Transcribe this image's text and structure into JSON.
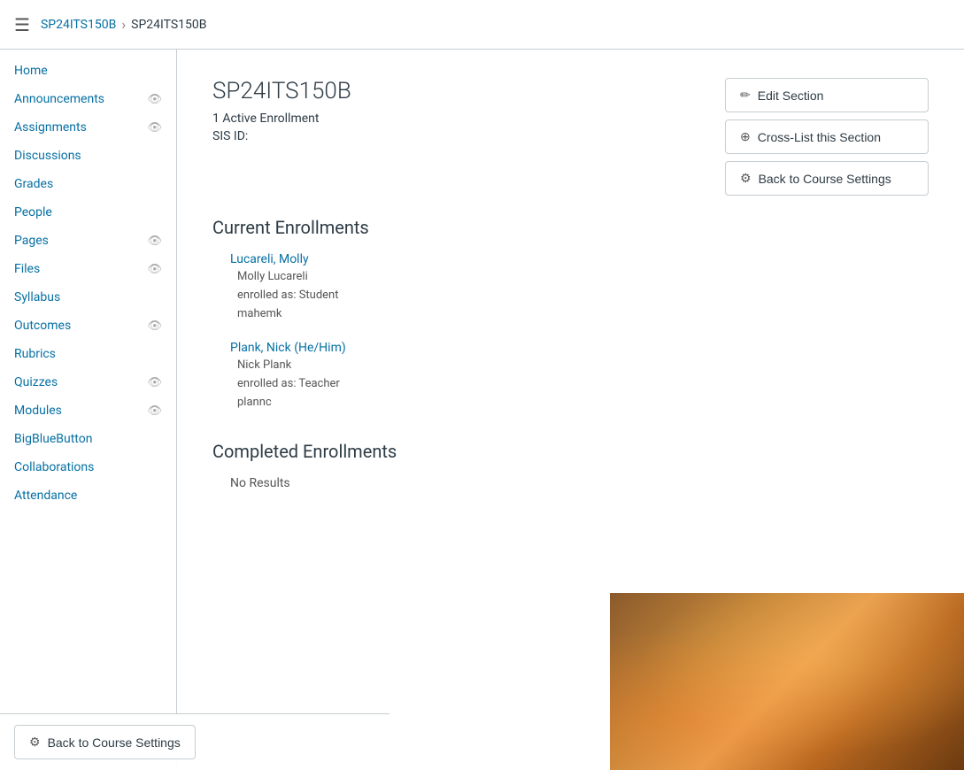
{
  "topbar": {
    "breadcrumb_link": "SP24ITS150B",
    "breadcrumb_current": "SP24ITS150B"
  },
  "sidebar": {
    "items": [
      {
        "label": "Home",
        "icon": "",
        "has_icon": false
      },
      {
        "label": "Announcements",
        "icon": "👁",
        "has_icon": true
      },
      {
        "label": "Assignments",
        "icon": "👁",
        "has_icon": true
      },
      {
        "label": "Discussions",
        "icon": "",
        "has_icon": false
      },
      {
        "label": "Grades",
        "icon": "",
        "has_icon": false
      },
      {
        "label": "People",
        "icon": "",
        "has_icon": false
      },
      {
        "label": "Pages",
        "icon": "👁",
        "has_icon": true
      },
      {
        "label": "Files",
        "icon": "👁",
        "has_icon": true
      },
      {
        "label": "Syllabus",
        "icon": "",
        "has_icon": false
      },
      {
        "label": "Outcomes",
        "icon": "👁",
        "has_icon": true
      },
      {
        "label": "Rubrics",
        "icon": "",
        "has_icon": false
      },
      {
        "label": "Quizzes",
        "icon": "👁",
        "has_icon": true
      },
      {
        "label": "Modules",
        "icon": "👁",
        "has_icon": true
      },
      {
        "label": "BigBlueButton",
        "icon": "",
        "has_icon": false
      },
      {
        "label": "Collaborations",
        "icon": "",
        "has_icon": false
      },
      {
        "label": "Attendance",
        "icon": "",
        "has_icon": false
      }
    ]
  },
  "main": {
    "section_name": "SP24ITS150B",
    "active_enrollment_count": "1 Active Enrollment",
    "sis_label": "SIS ID:",
    "sis_value": "",
    "current_enrollments_title": "Current Enrollments",
    "enrollments": [
      {
        "name": "Lucareli, Molly",
        "full_name": "Molly Lucareli",
        "enrolled_as": "enrolled as: Student",
        "username": "mahemk"
      },
      {
        "name": "Plank, Nick (He/Him)",
        "full_name": "Nick Plank",
        "enrolled_as": "enrolled as: Teacher",
        "username": "plannc"
      }
    ],
    "completed_enrollments_title": "Completed Enrollments",
    "no_results": "No Results"
  },
  "actions": {
    "edit_section": "Edit Section",
    "cross_list": "Cross-List this Section",
    "back_to_settings": "Back to Course Settings"
  },
  "bottom_bar": {
    "back_button": "Back to Course Settings"
  }
}
